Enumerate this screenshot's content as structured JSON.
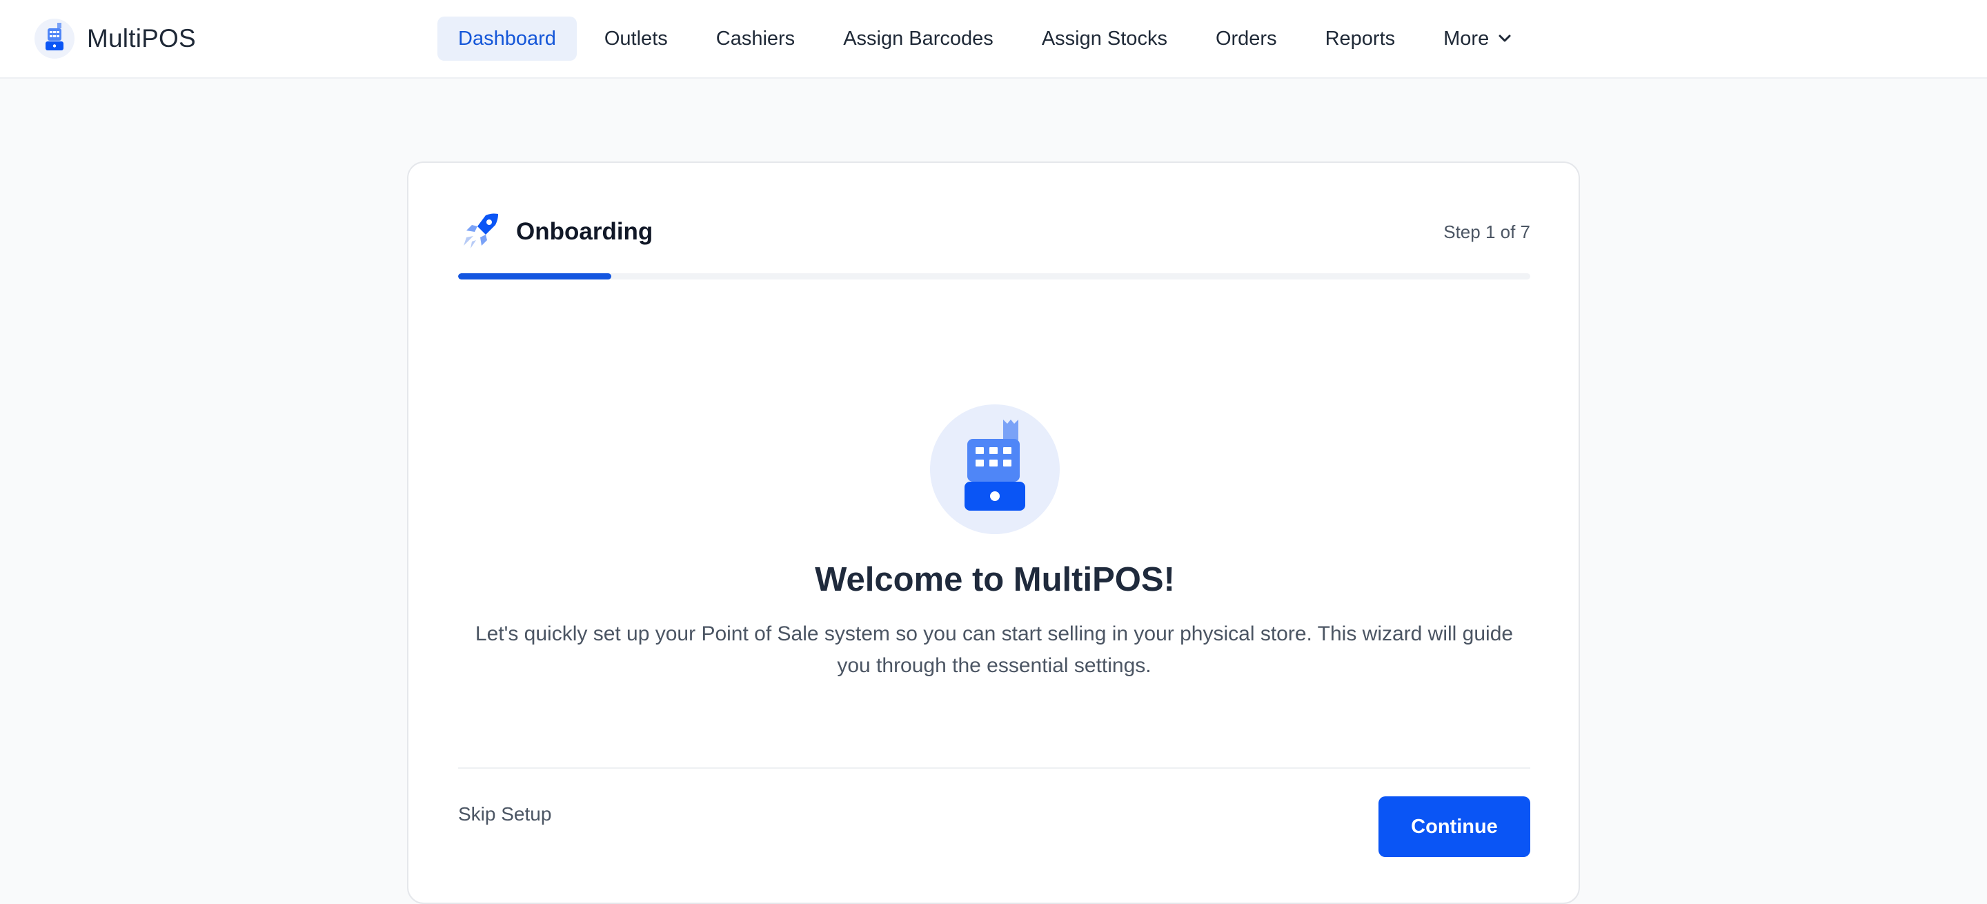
{
  "brand": {
    "name": "MultiPOS",
    "logo_icon": "cash-register-icon"
  },
  "nav": {
    "items": [
      {
        "label": "Dashboard",
        "active": true
      },
      {
        "label": "Outlets",
        "active": false
      },
      {
        "label": "Cashiers",
        "active": false
      },
      {
        "label": "Assign Barcodes",
        "active": false
      },
      {
        "label": "Assign Stocks",
        "active": false
      },
      {
        "label": "Orders",
        "active": false
      },
      {
        "label": "Reports",
        "active": false
      },
      {
        "label": "More",
        "active": false,
        "icon": "chevron-down-icon"
      }
    ]
  },
  "onboarding": {
    "title": "Onboarding",
    "title_icon": "rocket-icon",
    "step_text": "Step 1 of 7",
    "progress": {
      "current": 1,
      "total": 7
    },
    "hero_icon": "cash-register-icon",
    "welcome_title": "Welcome to MultiPOS!",
    "description": "Let's quickly set up your Point of Sale system so you can start selling in your physical store. This wizard will guide you through the essential settings.",
    "skip_label": "Skip Setup",
    "continue_label": "Continue"
  },
  "colors": {
    "accent": "#0a55f5",
    "nav_active_bg": "#eaf0fb",
    "nav_active_text": "#1456d8",
    "page_bg": "#f9fafb"
  }
}
